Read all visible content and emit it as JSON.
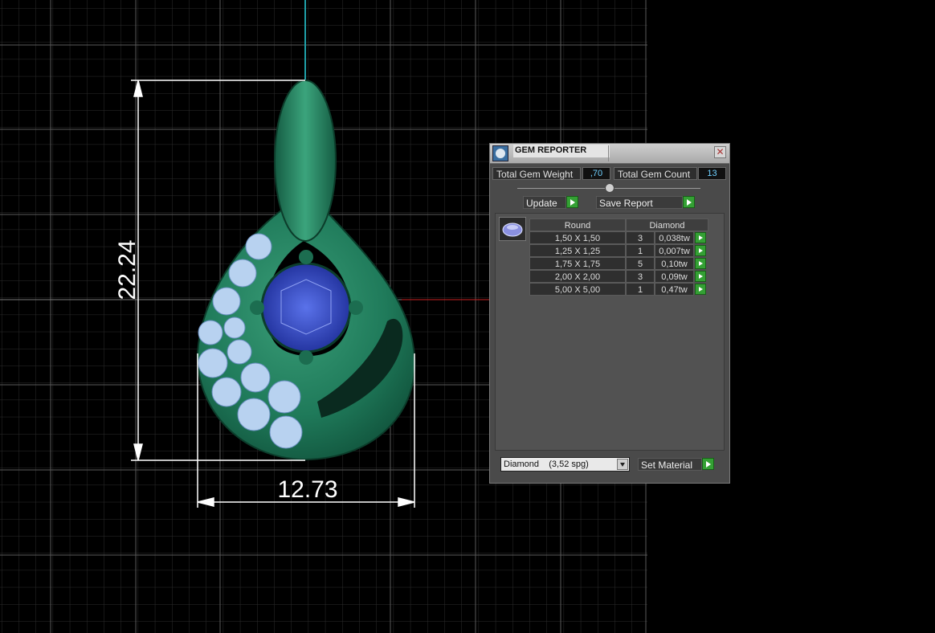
{
  "viewport": {
    "dimension_vertical": "22.24",
    "dimension_horizontal": "12.73"
  },
  "gem_reporter": {
    "title": "GEM REPORTER",
    "close_icon": "close-icon",
    "total_weight_label": "Total Gem Weight",
    "total_weight_value": ",70",
    "total_count_label": "Total Gem Count",
    "total_count_value": "13",
    "update_label": "Update",
    "save_report_label": "Save Report",
    "table": {
      "col_shape": "Round",
      "col_material": "Diamond",
      "rows": [
        {
          "size": "1,50 X 1,50",
          "count": "3",
          "weight": "0,038tw"
        },
        {
          "size": "1,25 X 1,25",
          "count": "1",
          "weight": "0,007tw"
        },
        {
          "size": "1,75 X 1,75",
          "count": "5",
          "weight": "0,10tw"
        },
        {
          "size": "2,00 X 2,00",
          "count": "3",
          "weight": "0,09tw"
        },
        {
          "size": "5,00 X 5,00",
          "count": "1",
          "weight": "0,47tw"
        }
      ]
    },
    "material_select": "Diamond    (3,52 spg)",
    "set_material_label": "Set Material"
  },
  "colors": {
    "pendant_metal": "#1f7a5a",
    "center_stone": "#2a3fb8",
    "side_stones": "#b8d2f0",
    "accent_go": "#34a034"
  }
}
